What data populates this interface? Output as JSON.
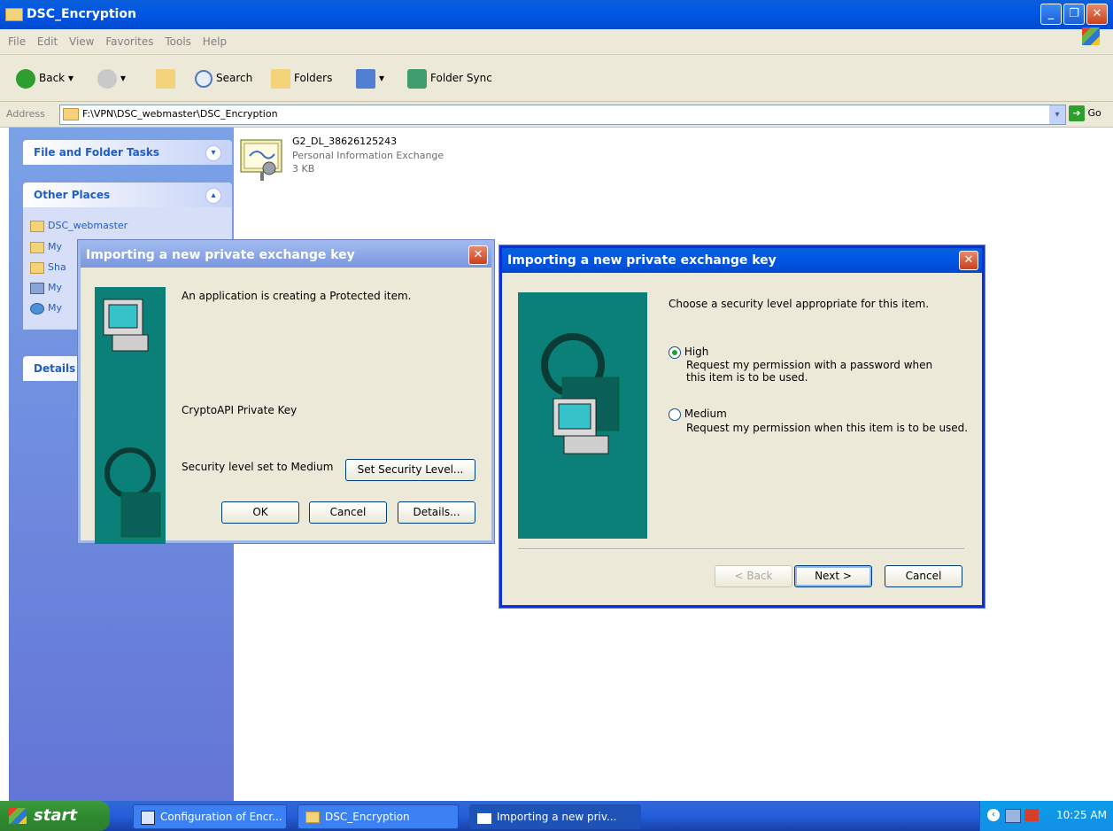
{
  "window": {
    "title": "DSC_Encryption"
  },
  "menu": [
    "File",
    "Edit",
    "View",
    "Favorites",
    "Tools",
    "Help"
  ],
  "toolbar": {
    "back": "Back",
    "search": "Search",
    "folders": "Folders",
    "folder_sync": "Folder Sync"
  },
  "address": {
    "label": "Address",
    "value": "F:\\VPN\\DSC_webmaster\\DSC_Encryption",
    "go": "Go"
  },
  "tasks": {
    "file_folder_tasks": "File and Folder Tasks",
    "other_places": "Other Places",
    "places": [
      "DSC_webmaster",
      "My",
      "Sha",
      "My",
      "My"
    ],
    "details": "Details"
  },
  "file": {
    "name": "G2_DL_38626125243",
    "type": "Personal Information Exchange",
    "size": "3 KB"
  },
  "dialog1": {
    "title": "Importing a new private exchange key",
    "message": "An application is creating a Protected item.",
    "item_name": "CryptoAPI Private Key",
    "security_status": "Security level set to Medium",
    "set_security_button": "Set Security Level...",
    "ok": "OK",
    "cancel": "Cancel",
    "details": "Details..."
  },
  "dialog2": {
    "title": "Importing a new private exchange key",
    "prompt": "Choose a security level appropriate for this item.",
    "high_label": "High",
    "high_desc": "Request my permission with a password when this item is to be used.",
    "medium_label": "Medium",
    "medium_desc": "Request my permission when this item is to be used.",
    "selected": "High",
    "back": "< Back",
    "next": "Next >",
    "cancel": "Cancel"
  },
  "taskbar": {
    "start": "start",
    "tasks": [
      "Configuration of Encr...",
      "DSC_Encryption",
      "Importing a new priv..."
    ],
    "clock": "10:25 AM"
  }
}
